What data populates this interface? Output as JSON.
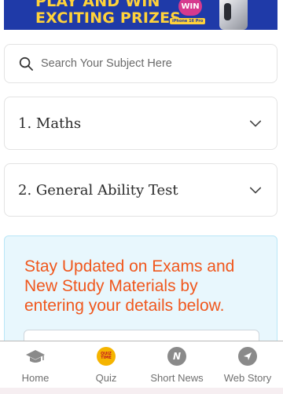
{
  "banner": {
    "line1": "PLAY AND WIN",
    "line2": "EXCITING PRIZES",
    "badge": "WIN",
    "tag": "iPhone 16 Pro"
  },
  "search": {
    "placeholder": "Search Your Subject Here",
    "icon": "search-icon"
  },
  "subjects": [
    {
      "label": "1. Maths",
      "icon": "chevron-down-icon"
    },
    {
      "label": "2. General Ability Test",
      "icon": "chevron-down-icon"
    }
  ],
  "newsletter": {
    "text": "Stay Updated on Exams and New Study Materials by entering your details below.",
    "color": "#f0571d"
  },
  "bottom_nav": [
    {
      "label": "Home",
      "icon": "graduation-cap-icon"
    },
    {
      "label": "Quiz",
      "icon": "quiz-time-icon",
      "icon_text": "QUIZ TIME"
    },
    {
      "label": "Short News",
      "icon": "news-n-icon",
      "icon_text": "N"
    },
    {
      "label": "Web Story",
      "icon": "web-story-icon"
    }
  ]
}
